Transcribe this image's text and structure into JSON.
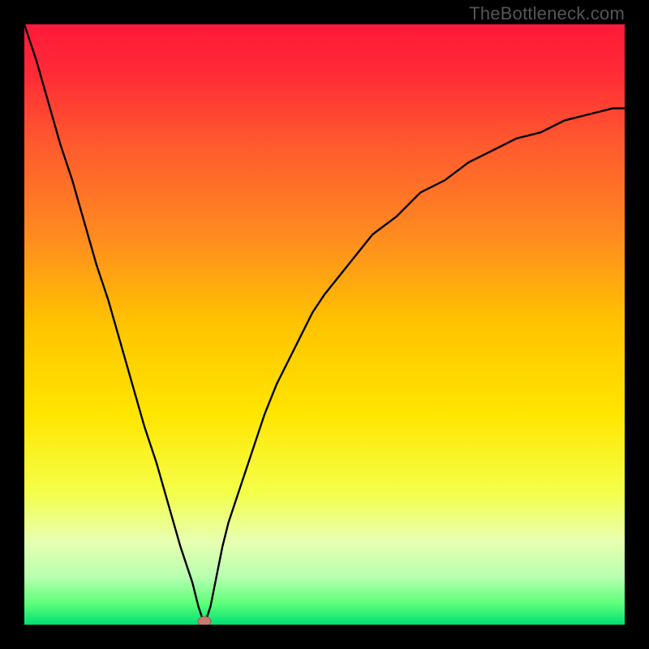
{
  "watermark": "TheBottleneck.com",
  "chart_data": {
    "type": "line",
    "title": "",
    "xlabel": "",
    "ylabel": "",
    "ylim": [
      0,
      100
    ],
    "xlim": [
      0,
      100
    ],
    "x": [
      0,
      2,
      4,
      6,
      8,
      10,
      12,
      14,
      16,
      18,
      20,
      22,
      24,
      26,
      28,
      29,
      30,
      31,
      32,
      33,
      34,
      36,
      38,
      40,
      42,
      44,
      46,
      48,
      50,
      54,
      58,
      62,
      66,
      70,
      74,
      78,
      82,
      86,
      90,
      94,
      98,
      100
    ],
    "values": [
      100,
      94,
      87,
      80,
      74,
      67,
      60,
      54,
      47,
      40,
      33,
      27,
      20,
      13,
      7,
      3,
      0,
      3,
      8,
      13,
      17,
      23,
      29,
      35,
      40,
      44,
      48,
      52,
      55,
      60,
      65,
      68,
      72,
      74,
      77,
      79,
      81,
      82,
      84,
      85,
      86,
      86
    ],
    "marker": {
      "x": 30,
      "y": 0
    },
    "gradient_stops": [
      {
        "offset": 0.0,
        "color": "#ff1a3a"
      },
      {
        "offset": 0.08,
        "color": "#ff2a36"
      },
      {
        "offset": 0.2,
        "color": "#ff5a2e"
      },
      {
        "offset": 0.35,
        "color": "#ff8a20"
      },
      {
        "offset": 0.5,
        "color": "#ffc400"
      },
      {
        "offset": 0.65,
        "color": "#ffe600"
      },
      {
        "offset": 0.78,
        "color": "#f4ff4a"
      },
      {
        "offset": 0.86,
        "color": "#e8ffb0"
      },
      {
        "offset": 0.92,
        "color": "#b8ffb0"
      },
      {
        "offset": 0.965,
        "color": "#5cff7a"
      },
      {
        "offset": 1.0,
        "color": "#00e070"
      }
    ],
    "colors": {
      "line": "#000000",
      "marker_fill": "#c77a6e",
      "marker_stroke": "#9a5a50",
      "background_frame": "#000000"
    }
  }
}
